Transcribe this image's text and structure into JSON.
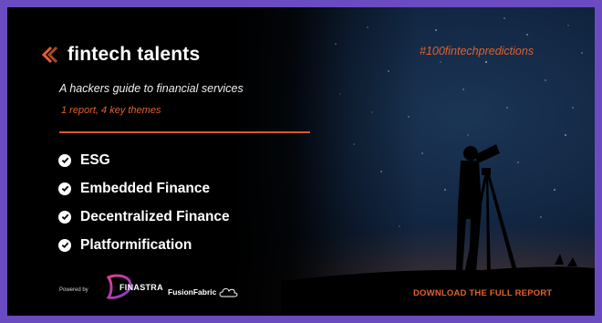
{
  "brand": {
    "name": "fintech talents",
    "icon": "stacked-chevron-logo-icon"
  },
  "subtitle": "A hackers guide to financial services",
  "tagline": "1 report, 4 key themes",
  "themes": [
    {
      "label": "ESG"
    },
    {
      "label": "Embedded Finance"
    },
    {
      "label": "Decentralized Finance"
    },
    {
      "label": "Platformification"
    }
  ],
  "powered_by": "Powered by",
  "partners": {
    "finastra": "FINASTRA",
    "fusion": "FusionFabric"
  },
  "hashtag": "#100fintechpredictions",
  "cta": "DOWNLOAD THE FULL REPORT",
  "colors": {
    "accent": "#e0612d",
    "background": "#050505",
    "page_border": "#6b4bc0"
  }
}
